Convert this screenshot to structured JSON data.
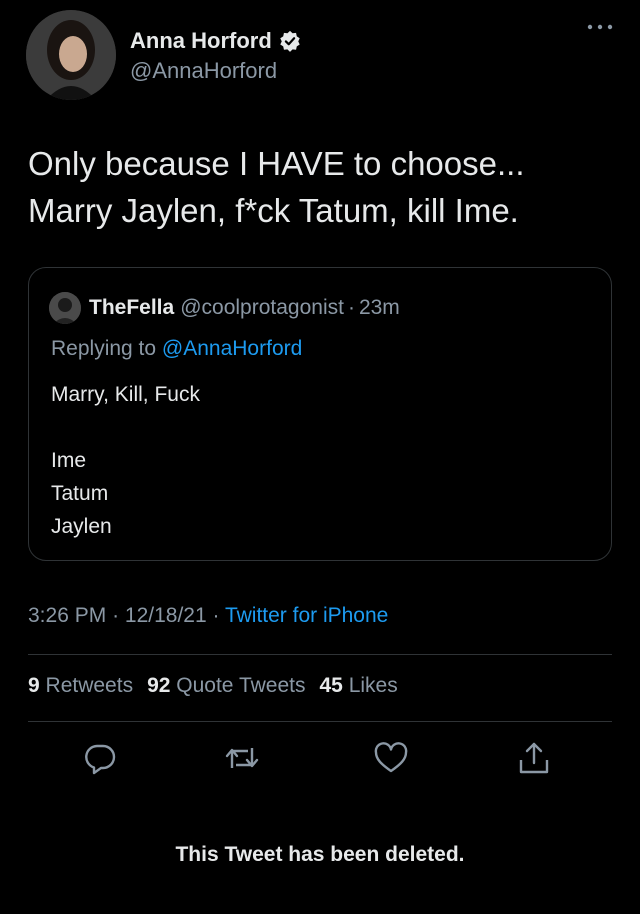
{
  "author": {
    "name": "Anna Horford",
    "handle": "@AnnaHorford",
    "verified_icon": "verified-badge-icon"
  },
  "tweet": {
    "text_line1": "Only because I HAVE to choose...",
    "text_line2": "Marry Jaylen, f*ck Tatum, kill Ime.",
    "time": "3:26 PM",
    "date": "12/18/21",
    "source": "Twitter for iPhone"
  },
  "quoted": {
    "name": "TheFella",
    "handle": "@coolprotagonist",
    "time": "23m",
    "replying_prefix": "Replying to",
    "replying_to": "@AnnaHorford",
    "text_line1": "Marry, Kill, Fuck",
    "names": [
      "Ime",
      "Tatum",
      "Jaylen"
    ]
  },
  "stats": {
    "retweets_count": "9",
    "retweets_label": "Retweets",
    "quotes_count": "92",
    "quotes_label": "Quote Tweets",
    "likes_count": "45",
    "likes_label": "Likes"
  },
  "actions": [
    "reply-icon",
    "retweet-icon",
    "like-icon",
    "share-icon"
  ],
  "footer": {
    "deleted_notice": "This Tweet has been deleted."
  },
  "colors": {
    "background": "#000000",
    "text": "#e7e9ea",
    "secondary": "#8b98a5",
    "link": "#1d9bf0",
    "border": "#2f3336"
  }
}
